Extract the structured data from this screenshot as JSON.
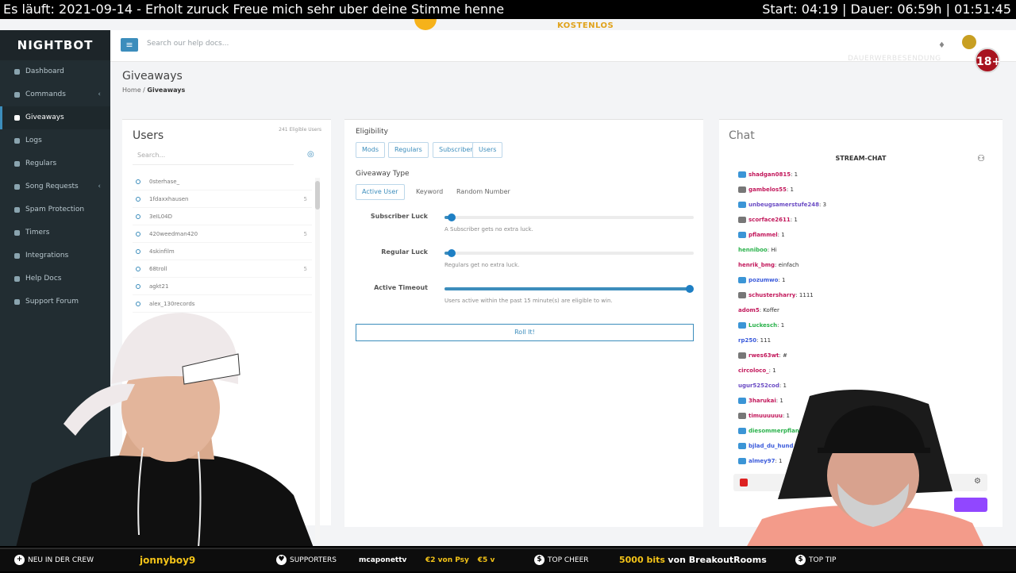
{
  "overlay": {
    "top_left": "Es läuft: 2021-09-14 - Erholt zuruck Freue mich sehr uber deine Stimme henne",
    "top_right": "Start: 04:19 | Dauer: 06:59h | 01:51:45"
  },
  "promo_text": "KOSTENLOS",
  "brand": "NIGHTBOT",
  "header": {
    "search_placeholder": "Search our help docs..."
  },
  "age_badge": "18+",
  "watermark": "DAUERWERBESENDUNG",
  "sidebar": {
    "items": [
      {
        "label": "Dashboard",
        "icon": "dashboard-icon",
        "chevron": ""
      },
      {
        "label": "Commands",
        "icon": "pencil-icon",
        "chevron": "‹"
      },
      {
        "label": "Giveaways",
        "icon": "gift-icon",
        "chevron": ""
      },
      {
        "label": "Logs",
        "icon": "log-icon",
        "chevron": ""
      },
      {
        "label": "Regulars",
        "icon": "star-icon",
        "chevron": ""
      },
      {
        "label": "Song Requests",
        "icon": "music-icon",
        "chevron": "‹"
      },
      {
        "label": "Spam Protection",
        "icon": "shield-icon",
        "chevron": ""
      },
      {
        "label": "Timers",
        "icon": "clock-icon",
        "chevron": ""
      },
      {
        "label": "Integrations",
        "icon": "plug-icon",
        "chevron": ""
      },
      {
        "label": "Help Docs",
        "icon": "help-icon",
        "chevron": ""
      },
      {
        "label": "Support Forum",
        "icon": "forum-icon",
        "chevron": ""
      }
    ],
    "active": "Giveaways"
  },
  "page": {
    "title": "Giveaways",
    "breadcrumb_home": "Home",
    "breadcrumb_current": "Giveaways"
  },
  "users_panel": {
    "title": "Users",
    "eligible": "241 Eligible Users",
    "search_placeholder": "Search...",
    "rows": [
      {
        "name": "0sterhase_",
        "count": ""
      },
      {
        "name": "1fdaxxhausen",
        "count": "5"
      },
      {
        "name": "3eIL04D",
        "count": ""
      },
      {
        "name": "420weedman420",
        "count": "5"
      },
      {
        "name": "4skinfilm",
        "count": ""
      },
      {
        "name": "68troll",
        "count": "5"
      },
      {
        "name": "agkt21",
        "count": ""
      },
      {
        "name": "alex_130records",
        "count": ""
      }
    ]
  },
  "giveaway": {
    "eligibility_title": "Eligibility",
    "eligibility_options": [
      "Mods",
      "Regulars",
      "Subscribers",
      "Users"
    ],
    "type_title": "Giveaway Type",
    "type_options": [
      "Active User",
      "Keyword",
      "Random Number"
    ],
    "active_type": "Active User",
    "sliders": [
      {
        "label": "Subscriber Luck",
        "value": 0,
        "hint": "A Subscriber gets no extra luck."
      },
      {
        "label": "Regular Luck",
        "value": 0,
        "hint": "Regulars get no extra luck."
      },
      {
        "label": "Active Timeout",
        "value": 1.0,
        "hint": "Users active within the past 15 minute(s) are eligible to win."
      }
    ],
    "roll_button": "Roll It!"
  },
  "chat": {
    "title": "Chat",
    "stream_chat_label": "STREAM-CHAT",
    "messages": [
      {
        "user": "shadgan0815",
        "text": ": 1",
        "color": "#c2185b",
        "badge": "sub"
      },
      {
        "user": "gambelos55",
        "text": ": 1",
        "color": "#c2185b",
        "badge": "gray"
      },
      {
        "user": "unbeugsamerstufe248",
        "text": ": 3",
        "color": "#6a4bc4",
        "badge": "sub"
      },
      {
        "user": "scorface2611",
        "text": ": 1",
        "color": "#c2185b",
        "badge": "gray"
      },
      {
        "user": "pflammel",
        "text": ": 1",
        "color": "#c2185b",
        "badge": "sub"
      },
      {
        "user": "henniboo",
        "text": ": Hi",
        "color": "#2bb24c",
        "badge": ""
      },
      {
        "user": "henrik_bmg",
        "text": ": einfach",
        "color": "#c2185b",
        "badge": ""
      },
      {
        "user": "pozumwo",
        "text": ": 1",
        "color": "#3b5bdb",
        "badge": "sub"
      },
      {
        "user": "schustersharry",
        "text": ": 1111",
        "color": "#c2185b",
        "badge": "gray"
      },
      {
        "user": "adom5",
        "text": ": Koffer",
        "color": "#c2185b",
        "badge": ""
      },
      {
        "user": "Luckesch",
        "text": ": 1",
        "color": "#2bb24c",
        "badge": "sub"
      },
      {
        "user": "rp250",
        "text": ": 111",
        "color": "#3b5bdb",
        "badge": ""
      },
      {
        "user": "rwes63wt",
        "text": ": #",
        "color": "#c2185b",
        "badge": "gray"
      },
      {
        "user": "circoloco_",
        "text": ": 1",
        "color": "#c2185b",
        "badge": ""
      },
      {
        "user": "ugur5252cod",
        "text": ": 1",
        "color": "#6a4bc4",
        "badge": ""
      },
      {
        "user": "3harukai",
        "text": ": 1",
        "color": "#c2185b",
        "badge": "sub"
      },
      {
        "user": "timuuuuuu",
        "text": ": 1",
        "color": "#c2185b",
        "badge": "gray"
      },
      {
        "user": "diesommerpflanze",
        "text": "",
        "color": "#2bb24c",
        "badge": "sub"
      },
      {
        "user": "bjlad_du_hund",
        "text": "",
        "color": "#3b5bdb",
        "badge": "sub"
      },
      {
        "user": "almey97",
        "text": ": 1",
        "color": "#3b5bdb",
        "badge": "sub"
      }
    ]
  },
  "ticker": {
    "new_crew_label": "NEU IN DER CREW",
    "new_crew_name": "jonnyboy9",
    "supporters_label": "SUPPORTERS",
    "supporter_name": "mcaponettv",
    "supporter_amount_1": "€2 von Psy",
    "supporter_amount_2": "€5 v",
    "top_cheer_label": "TOP CHEER",
    "top_cheer_value": "5000 bits",
    "top_cheer_from": "von BreakoutRooms",
    "top_tip_label": "TOP TIP"
  },
  "colors": {
    "accent": "#3c8dbc",
    "sidebar_bg": "#222d32",
    "twitch": "#9147ff",
    "ticker_highlight": "#f3c318"
  }
}
